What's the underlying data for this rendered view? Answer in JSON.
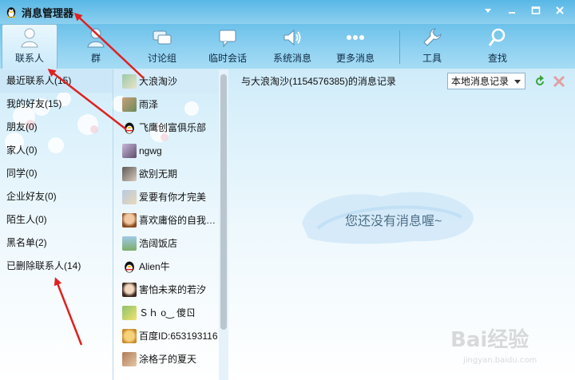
{
  "window": {
    "title": "消息管理器"
  },
  "toolbar": {
    "items": [
      {
        "label": "联系人",
        "icon": "contacts-icon"
      },
      {
        "label": "群",
        "icon": "group-icon"
      },
      {
        "label": "讨论组",
        "icon": "discussion-icon"
      },
      {
        "label": "临时会话",
        "icon": "temp-chat-icon"
      },
      {
        "label": "系统消息",
        "icon": "speaker-icon"
      },
      {
        "label": "更多消息",
        "icon": "more-icon"
      },
      {
        "label": "工具",
        "icon": "wrench-icon"
      },
      {
        "label": "查找",
        "icon": "search-icon"
      }
    ]
  },
  "categories": [
    "最近联系人(15)",
    "我的好友(15)",
    "朋友(0)",
    "家人(0)",
    "同学(0)",
    "企业好友(0)",
    "陌生人(0)",
    "黑名单(2)",
    "已删除联系人(14)"
  ],
  "contacts": [
    "大浪淘沙",
    "雨泽",
    "飞鹰创富俱乐部",
    "ngwg",
    "欲别无期",
    "爱要有你才完美",
    "喜欢庸俗的自我陶…",
    "浩阔饭店",
    "Alien牛",
    "害怕未来的若汐",
    "Ｓｈ о‿ 傻ㄖ",
    "百度ID:653193116",
    "涂格子的夏天"
  ],
  "messages": {
    "header": "与大浪淘沙(1154576385)的消息记录",
    "source_selected": "本地消息记录",
    "empty_text": "您还没有消息喔~"
  },
  "watermark": {
    "text": "Bai经验",
    "sub": "jingyan.baidu.com"
  },
  "colors": {
    "accent": "#58b7e6",
    "toolbar": "#8fd1f1",
    "arrow": "#e02020",
    "selected": "#cbe7f8"
  }
}
